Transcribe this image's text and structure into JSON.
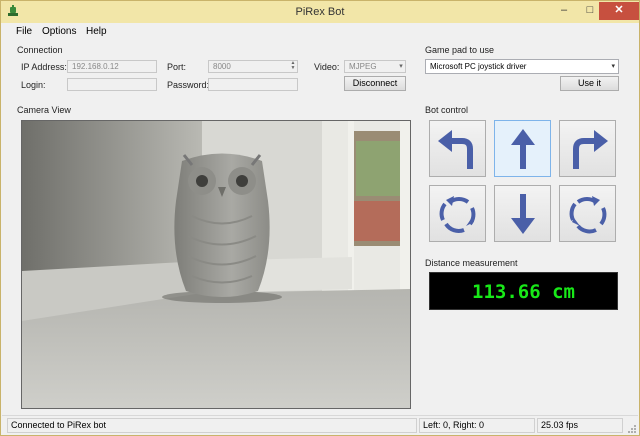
{
  "window": {
    "title": "PiRex Bot"
  },
  "menu": [
    "File",
    "Options",
    "Help"
  ],
  "connection": {
    "group_label": "Connection",
    "ip_label": "IP Address:",
    "ip_value": "192.168.0.12",
    "port_label": "Port:",
    "port_value": "8000",
    "video_label": "Video:",
    "video_value": "MJPEG",
    "login_label": "Login:",
    "login_value": "",
    "password_label": "Password:",
    "password_value": "",
    "disconnect_label": "Disconnect"
  },
  "gamepad": {
    "group_label": "Game pad to use",
    "selected": "Microsoft PC joystick driver",
    "use_label": "Use it"
  },
  "camera": {
    "group_label": "Camera View"
  },
  "bot_control": {
    "group_label": "Bot control",
    "buttons": [
      {
        "name": "turn-left-forward",
        "icon": "arrow-turn-left-icon"
      },
      {
        "name": "forward",
        "icon": "arrow-up-icon"
      },
      {
        "name": "turn-right-forward",
        "icon": "arrow-turn-right-icon"
      },
      {
        "name": "rotate-left",
        "icon": "rotate-counterclockwise-icon"
      },
      {
        "name": "backward",
        "icon": "arrow-down-icon"
      },
      {
        "name": "rotate-right",
        "icon": "rotate-clockwise-icon"
      }
    ],
    "accent": "#4a5fa8"
  },
  "distance": {
    "group_label": "Distance measurement",
    "value": "113.66 cm",
    "color": "#18e818"
  },
  "status": {
    "connection": "Connected to PiRex bot",
    "motors": "Left: 0, Right: 0",
    "fps": "25.03 fps"
  }
}
